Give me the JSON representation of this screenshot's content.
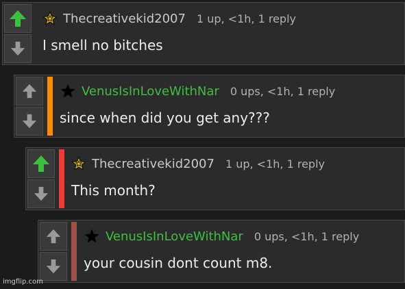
{
  "colors": {
    "upvote_active": "#3fbf3f",
    "vote_inactive": "#9a9a9a",
    "username_default": "#c9c9c9",
    "username_green": "#3fbf3f",
    "depth_orange": "#ff8c00",
    "depth_red": "#ef3a3a",
    "depth_muted": "#a0524a"
  },
  "comments": [
    {
      "username": "Thecreativekid2007",
      "meta": "1 up, <1h, 1 reply",
      "text": "I smell no bitches",
      "upvoted": true,
      "badge_icon": "gold-star-icon"
    },
    {
      "username": "VenusIsInLoveWithNar",
      "meta": "0 ups, <1h, 1 reply",
      "text": "since when did you get any???",
      "upvoted": false,
      "badge_icon": "black-star-icon"
    },
    {
      "username": "Thecreativekid2007",
      "meta": "1 up, <1h, 1 reply",
      "text": "This month?",
      "upvoted": true,
      "badge_icon": "gold-star-icon"
    },
    {
      "username": "VenusIsInLoveWithNar",
      "meta": "0 ups, <1h, 1 reply",
      "text": "your cousin dont count m8.",
      "upvoted": false,
      "badge_icon": "black-star-icon"
    }
  ],
  "watermark": "imgflip.com"
}
